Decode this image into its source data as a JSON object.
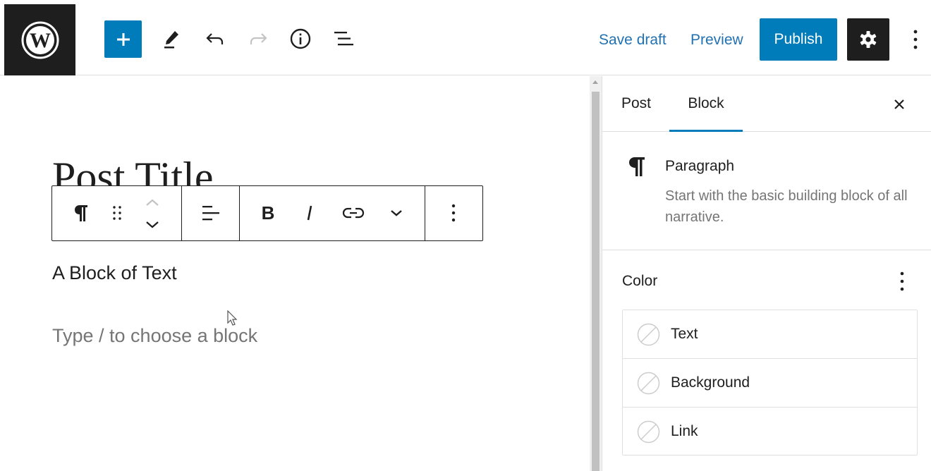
{
  "topbar": {
    "save_draft": "Save draft",
    "preview": "Preview",
    "publish": "Publish",
    "accent_color": "#007cba"
  },
  "editor": {
    "post_title": "Post Title",
    "paragraph": "A Block of Text",
    "appender_placeholder": "Type / to choose a block"
  },
  "sidebar": {
    "tabs": [
      {
        "label": "Post",
        "active": false
      },
      {
        "label": "Block",
        "active": true
      }
    ],
    "block_card": {
      "title": "Paragraph",
      "description": "Start with the basic building block of all narrative."
    },
    "color_panel": {
      "title": "Color",
      "items": [
        {
          "label": "Text"
        },
        {
          "label": "Background"
        },
        {
          "label": "Link"
        }
      ]
    }
  }
}
